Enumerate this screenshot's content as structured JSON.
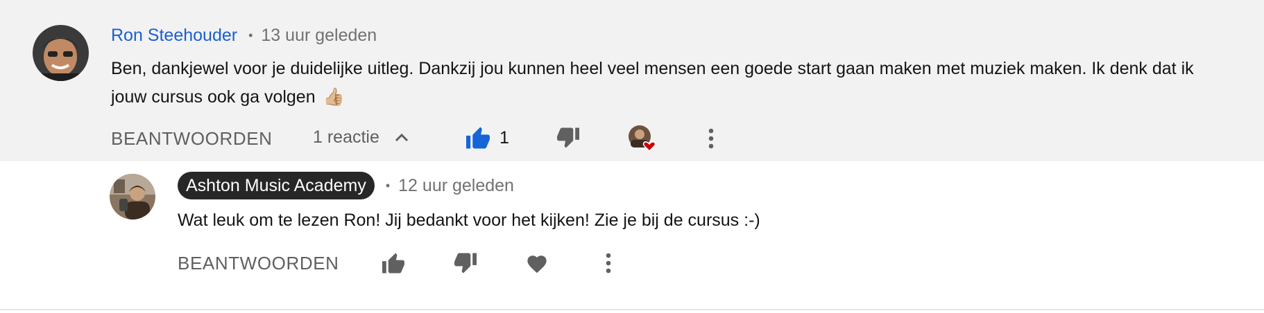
{
  "comment": {
    "author": "Ron Steehouder",
    "time": "13 uur geleden",
    "text_line1": "Ben, dankjewel voor je duidelijke uitleg. Dankzij jou kunnen heel veel mensen een goede start gaan maken met muziek maken. Ik denk dat ik",
    "text_line2": "jouw cursus ook ga volgen",
    "emoji": "👍🏼",
    "reply_label": "BEANTWOORDEN",
    "replies_label": "1 reactie",
    "like_count": "1",
    "separator": "•"
  },
  "reply": {
    "author": "Ashton Music Academy",
    "time": "12 uur geleden",
    "text": "Wat leuk om te lezen Ron! Jij bedankt voor het kijken! Zie je bij de cursus :-)",
    "reply_label": "BEANTWOORDEN",
    "separator": "•"
  },
  "colors": {
    "link_blue": "#1a5fd0",
    "like_active": "#1565d8",
    "heart_red": "#cc0000",
    "icon_grey": "#606060",
    "main_bg": "#f2f2f2"
  },
  "icons": {
    "main_like": "thumbs-up-filled-icon",
    "main_dislike": "thumbs-down-icon",
    "main_creator_heart": "creator-heart-icon",
    "main_more": "more-vertical-icon",
    "replies_chevron": "chevron-up-icon",
    "reply_like": "thumbs-up-icon",
    "reply_dislike": "thumbs-down-icon",
    "reply_heart": "heart-icon",
    "reply_more": "more-vertical-icon"
  }
}
